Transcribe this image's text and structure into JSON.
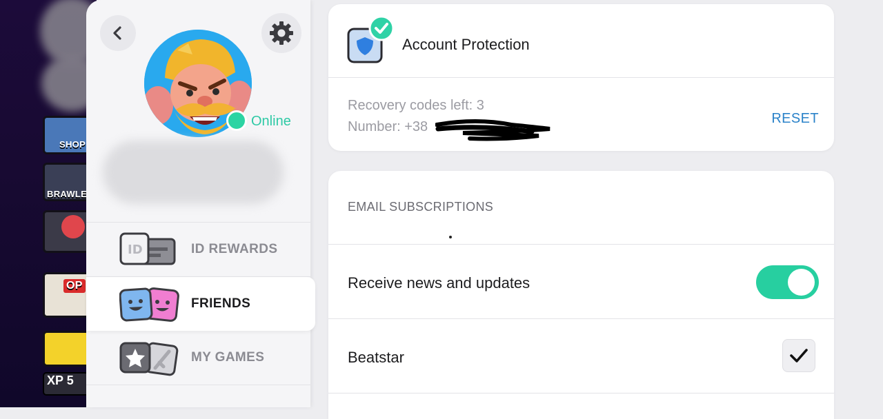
{
  "game_background": {
    "labels": [
      "SHOP",
      "BRAWLE",
      "OP",
      "XP 5"
    ]
  },
  "drawer": {
    "status": "Online",
    "menu": [
      {
        "label": "ID REWARDS",
        "icon": "id-card-icon"
      },
      {
        "label": "FRIENDS",
        "icon": "friends-faces-icon"
      },
      {
        "label": "MY GAMES",
        "icon": "games-star-sword-icon"
      }
    ]
  },
  "account_protection": {
    "title": "Account Protection",
    "recovery_codes": "Recovery codes left: 3",
    "number": "Number: +38",
    "reset_label": "RESET"
  },
  "email_subscriptions": {
    "heading": "EMAIL SUBSCRIPTIONS",
    "news_label": "Receive news and updates",
    "news_enabled": true,
    "game_label": "Beatstar",
    "game_checked": true
  },
  "colors": {
    "accent_green": "#27cfa0",
    "link_blue": "#2a82c9",
    "avatar_bg": "#29a9ee"
  }
}
